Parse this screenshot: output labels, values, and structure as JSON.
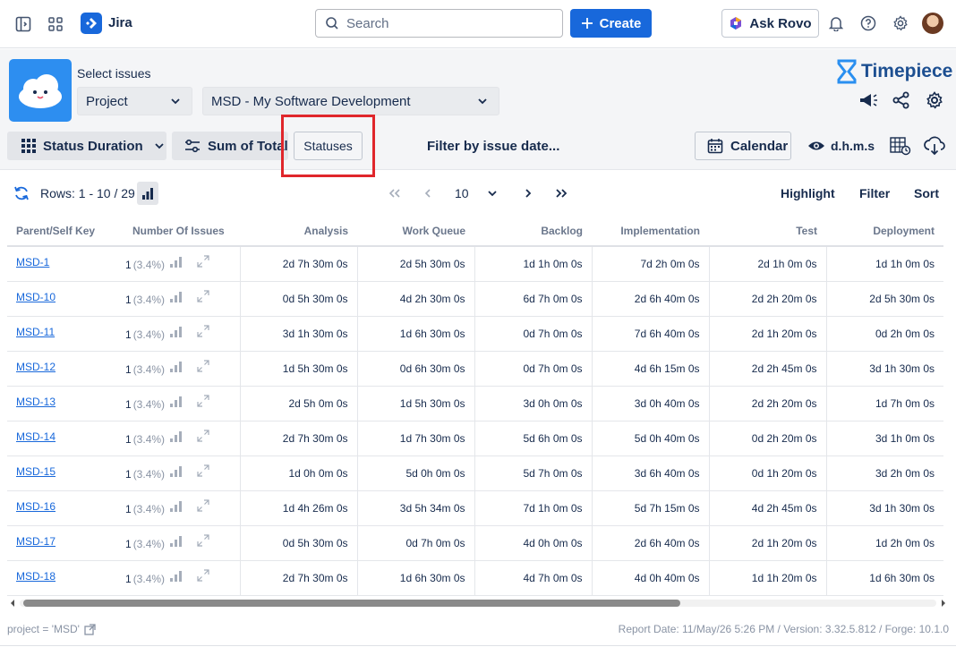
{
  "topbar": {
    "app_name": "Jira",
    "search_placeholder": "Search",
    "create_label": "Create",
    "rovo_label": "Ask Rovo"
  },
  "header": {
    "select_label": "Select issues",
    "project_select": "Project",
    "project_value": "MSD - My Software Development",
    "brand": "Timepiece"
  },
  "toolbar": {
    "report_type": "Status Duration",
    "sum_label": "Sum of Total",
    "statuses_label": "Statuses",
    "filter_date_label": "Filter by issue date...",
    "calendar_label": "Calendar",
    "time_format": "d.h.m.s"
  },
  "rowsbar": {
    "rows_text": "Rows: 1 - 10 / 29",
    "page_size": "10",
    "highlight_label": "Highlight",
    "filter_label": "Filter",
    "sort_label": "Sort"
  },
  "table": {
    "headers": [
      "Parent/Self Key",
      "Number Of Issues",
      "Analysis",
      "Work Queue",
      "Backlog",
      "Implementation",
      "Test",
      "Deployment"
    ],
    "rows": [
      {
        "key": "MSD-1",
        "count": "1",
        "pct": "(3.4%)",
        "vals": [
          "2d 7h 30m 0s",
          "2d 5h 30m 0s",
          "1d 1h 0m 0s",
          "7d 2h 0m 0s",
          "2d 1h 0m 0s",
          "1d 1h 0m 0s"
        ]
      },
      {
        "key": "MSD-10",
        "count": "1",
        "pct": "(3.4%)",
        "vals": [
          "0d 5h 30m 0s",
          "4d 2h 30m 0s",
          "6d 7h 0m 0s",
          "2d 6h 40m 0s",
          "2d 2h 20m 0s",
          "2d 5h 30m 0s"
        ]
      },
      {
        "key": "MSD-11",
        "count": "1",
        "pct": "(3.4%)",
        "vals": [
          "3d 1h 30m 0s",
          "1d 6h 30m 0s",
          "0d 7h 0m 0s",
          "7d 6h 40m 0s",
          "2d 1h 20m 0s",
          "0d 2h 0m 0s"
        ]
      },
      {
        "key": "MSD-12",
        "count": "1",
        "pct": "(3.4%)",
        "vals": [
          "1d 5h 30m 0s",
          "0d 6h 30m 0s",
          "0d 7h 0m 0s",
          "4d 6h 15m 0s",
          "2d 2h 45m 0s",
          "3d 1h 30m 0s"
        ]
      },
      {
        "key": "MSD-13",
        "count": "1",
        "pct": "(3.4%)",
        "vals": [
          "2d 5h 0m 0s",
          "1d 5h 30m 0s",
          "3d 0h 0m 0s",
          "3d 0h 40m 0s",
          "2d 2h 20m 0s",
          "1d 7h 0m 0s"
        ]
      },
      {
        "key": "MSD-14",
        "count": "1",
        "pct": "(3.4%)",
        "vals": [
          "2d 7h 30m 0s",
          "1d 7h 30m 0s",
          "5d 6h 0m 0s",
          "5d 0h 40m 0s",
          "0d 2h 20m 0s",
          "3d 1h 0m 0s"
        ]
      },
      {
        "key": "MSD-15",
        "count": "1",
        "pct": "(3.4%)",
        "vals": [
          "1d 0h 0m 0s",
          "5d 0h 0m 0s",
          "5d 7h 0m 0s",
          "3d 6h 40m 0s",
          "0d 1h 20m 0s",
          "3d 2h 0m 0s"
        ]
      },
      {
        "key": "MSD-16",
        "count": "1",
        "pct": "(3.4%)",
        "vals": [
          "1d 4h 26m 0s",
          "3d 5h 34m 0s",
          "7d 1h 0m 0s",
          "5d 7h 15m 0s",
          "4d 2h 45m 0s",
          "3d 1h 30m 0s"
        ]
      },
      {
        "key": "MSD-17",
        "count": "1",
        "pct": "(3.4%)",
        "vals": [
          "0d 5h 30m 0s",
          "0d 7h 0m 0s",
          "4d 0h 0m 0s",
          "2d 6h 40m 0s",
          "2d 1h 20m 0s",
          "1d 2h 0m 0s"
        ]
      },
      {
        "key": "MSD-18",
        "count": "1",
        "pct": "(3.4%)",
        "vals": [
          "2d 7h 30m 0s",
          "1d 6h 30m 0s",
          "4d 7h 0m 0s",
          "4d 0h 40m 0s",
          "1d 1h 20m 0s",
          "1d 6h 30m 0s"
        ]
      }
    ]
  },
  "footer": {
    "query": "project = 'MSD'",
    "report_info": "Report Date: 11/May/26 5:26 PM / Version: 3.32.5.812 / Forge: 10.1.0"
  },
  "colors": {
    "brand_blue": "#1868db",
    "highlight_red": "#e0262b"
  }
}
